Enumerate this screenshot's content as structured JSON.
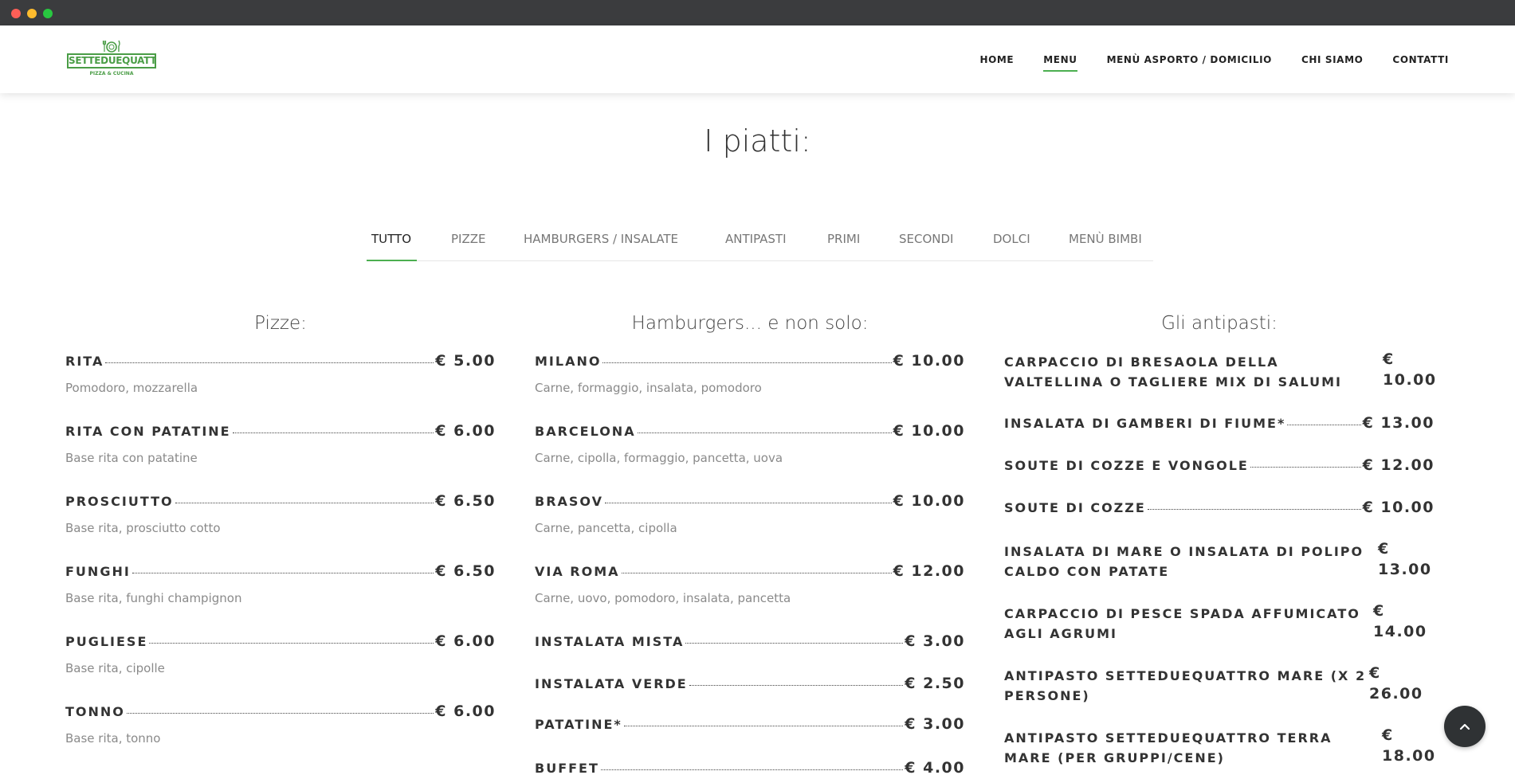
{
  "navbar": {
    "logo_text": "SETTEDUEQUATTRO",
    "logo_sub": "PIZZA & CUCINA",
    "items": [
      "HOME",
      "MENU",
      "MENÙ ASPORTO / DOMICILIO",
      "CHI SIAMO",
      "CONTATTI"
    ],
    "active_item": "MENU"
  },
  "page_title": "I piatti:",
  "tabs": {
    "items": [
      "TUTTO",
      "PIZZE",
      "HAMBURGERS / INSALATE",
      "ANTIPASTI",
      "PRIMI",
      "SECONDI",
      "DOLCI",
      "MENÙ BIMBI"
    ],
    "active": "TUTTO"
  },
  "pizze": {
    "title": "Pizze:",
    "items": [
      {
        "name": "RITA",
        "price": "€ 5.00",
        "desc": "Pomodoro, mozzarella"
      },
      {
        "name": "RITA CON PATATINE",
        "price": "€ 6.00",
        "desc": "Base rita con patatine"
      },
      {
        "name": "PROSCIUTTO",
        "price": "€ 6.50",
        "desc": "Base rita, prosciutto cotto"
      },
      {
        "name": "FUNGHI",
        "price": "€ 6.50",
        "desc": "Base rita, funghi champignon"
      },
      {
        "name": "PUGLIESE",
        "price": "€ 6.00",
        "desc": "Base rita, cipolle"
      },
      {
        "name": "TONNO",
        "price": "€ 6.00",
        "desc": "Base rita, tonno"
      }
    ]
  },
  "hamburgers": {
    "title": "Hamburgers... e non solo:",
    "items": [
      {
        "name": "MILANO",
        "price": "€ 10.00",
        "desc": "Carne, formaggio, insalata, pomodoro"
      },
      {
        "name": "BARCELONA",
        "price": "€ 10.00",
        "desc": "Carne, cipolla, formaggio, pancetta, uova"
      },
      {
        "name": "BRASOV",
        "price": "€ 10.00",
        "desc": "Carne, pancetta, cipolla"
      },
      {
        "name": "VIA ROMA",
        "price": "€ 12.00",
        "desc": "Carne, uovo, pomodoro, insalata, pancetta"
      },
      {
        "name": "INSTALATA MISTA",
        "price": "€ 3.00",
        "desc": ""
      },
      {
        "name": "INSTALATA VERDE",
        "price": "€ 2.50",
        "desc": ""
      },
      {
        "name": "PATATINE*",
        "price": "€ 3.00",
        "desc": ""
      },
      {
        "name": "BUFFET",
        "price": "€ 4.00",
        "desc": ""
      }
    ]
  },
  "antipasti": {
    "title": "Gli antipasti:",
    "items": [
      {
        "name": "CARPACCIO DI BRESAOLA DELLA VALTELLINA O TAGLIERE MIX DI SALUMI",
        "price_symbol": "€",
        "price_value": "10.00"
      },
      {
        "name": "INSALATA DI GAMBERI DI FIUME*",
        "price": "€ 13.00"
      },
      {
        "name": "SOUTE DI COZZE E VONGOLE",
        "price": "€ 12.00"
      },
      {
        "name": "SOUTE DI COZZE",
        "price": "€ 10.00"
      },
      {
        "name": "INSALATA DI MARE O INSALATA DI POLIPO CALDO CON PATATE",
        "price_symbol": "€",
        "price_value": "13.00"
      },
      {
        "name": "CARPACCIO DI PESCE SPADA AFFUMICATO AGLI AGRUMI",
        "price_symbol": "€",
        "price_value": "14.00"
      },
      {
        "name": "ANTIPASTO SETTEDUEQUATTRO MARE (X 2 PERSONE)",
        "price_symbol": "€",
        "price_value": "26.00"
      },
      {
        "name": "ANTIPASTO SETTEDUEQUATTRO TERRA MARE (PER GRUPPI/CENE)",
        "price_symbol": "€",
        "price_value": "18.00"
      }
    ]
  },
  "icons": {
    "logo": "fork-knife-plate-icon",
    "back_to_top": "chevron-up-icon"
  },
  "colors": {
    "accent": "#4caf50",
    "logo_green": "#4a9d46",
    "titlebar": "#3b3c3e",
    "back_to_top_bg": "#2f3234"
  }
}
